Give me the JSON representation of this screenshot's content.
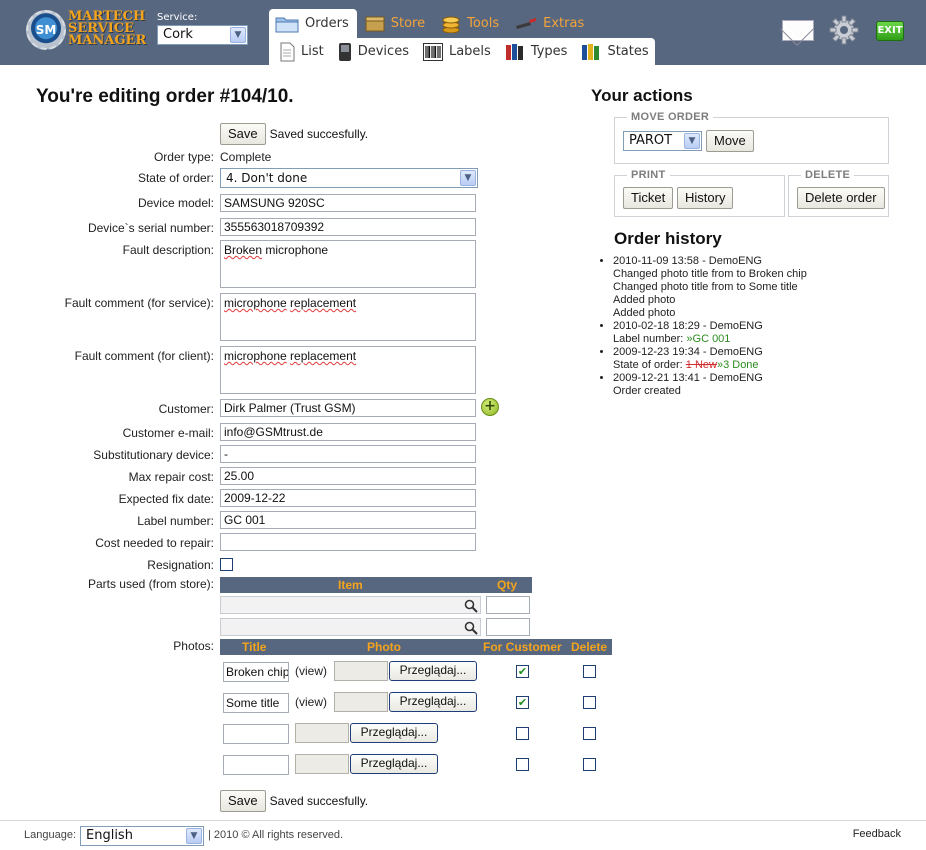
{
  "brand": {
    "logo_badge": "SM",
    "logo_line1": "Martech",
    "logo_line2": "Service",
    "logo_line3": "Manager",
    "accent": "#f4a41c",
    "header_bg": "#57677f"
  },
  "service": {
    "label": "Service:",
    "value": "Cork"
  },
  "nav": {
    "main_tabs": [
      {
        "label": "Orders",
        "icon": "folder-icon"
      },
      {
        "label": "Store",
        "icon": "box-icon"
      },
      {
        "label": "Tools",
        "icon": "coins-icon"
      },
      {
        "label": "Extras",
        "icon": "tools-icon"
      }
    ],
    "sub_tabs": [
      {
        "label": "List",
        "icon": "document-icon"
      },
      {
        "label": "Devices",
        "icon": "phone-icon"
      },
      {
        "label": "Labels",
        "icon": "barcode-icon"
      },
      {
        "label": "Types",
        "icon": "books-icon"
      },
      {
        "label": "States",
        "icon": "books-icon"
      }
    ],
    "exit_label": "EXIT"
  },
  "page_title": "You're editing order #104/10.",
  "save": {
    "button": "Save",
    "message": "Saved succesfully."
  },
  "form": {
    "order_type": {
      "label": "Order type:",
      "value": "Complete"
    },
    "state": {
      "label": "State of order:",
      "value": "4. Don't done"
    },
    "device_model": {
      "label": "Device model:",
      "value": "SAMSUNG 920SC"
    },
    "serial": {
      "label": "Device`s serial number:",
      "value": "355563018709392"
    },
    "fault_description": {
      "label": "Fault description:",
      "value_a": "Broken",
      "value_b": "microphone"
    },
    "fault_comment_service": {
      "label": "Fault comment (for service):",
      "value_a": "microphone",
      "value_b": "replacement"
    },
    "fault_comment_client": {
      "label": "Fault comment (for client):",
      "value_a": "microphone",
      "value_b": "replacement"
    },
    "customer": {
      "label": "Customer:",
      "value": "Dirk Palmer (Trust GSM)"
    },
    "email": {
      "label": "Customer e-mail:",
      "value": "info@GSMtrust.de"
    },
    "substitutionary": {
      "label": "Substitutionary device:",
      "value": "-"
    },
    "max_cost": {
      "label": "Max repair cost:",
      "value": "25.00"
    },
    "fix_date": {
      "label": "Expected fix date:",
      "value": "2009-12-22"
    },
    "label_number": {
      "label": "Label number:",
      "value": "GC 001"
    },
    "cost_needed": {
      "label": "Cost needed to repair:",
      "value": ""
    },
    "resignation": {
      "label": "Resignation:",
      "checked": false
    },
    "parts": {
      "label": "Parts used (from store):",
      "col_item": "Item",
      "col_qty": "Qty"
    },
    "photos": {
      "label": "Photos:",
      "col_title": "Title",
      "col_photo": "Photo",
      "col_for_customer": "For Customer",
      "col_delete": "Delete",
      "view_label": "(view)",
      "browse_label": "Przeglądaj...",
      "rows": [
        {
          "title": "Broken chip",
          "for_customer": true,
          "delete": false
        },
        {
          "title": "Some title",
          "for_customer": true,
          "delete": false
        },
        {
          "title": "",
          "for_customer": false,
          "delete": false
        },
        {
          "title": "",
          "for_customer": false,
          "delete": false
        }
      ]
    }
  },
  "actions": {
    "title": "Your actions",
    "move_legend": "MOVE ORDER",
    "move_target": "PAROT",
    "move_button": "Move",
    "print_legend": "PRINT",
    "ticket_button": "Ticket",
    "history_button": "History",
    "delete_legend": "DELETE",
    "delete_button": "Delete order"
  },
  "history": {
    "title": "Order history",
    "entries": [
      {
        "header": "2010-11-09 13:58 - DemoENG",
        "lines": [
          "Changed photo title from to Broken chip",
          "Changed photo title from to Some title",
          "Added photo",
          "Added photo"
        ]
      },
      {
        "header": "2010-02-18 18:29 - DemoENG",
        "label_prefix": "Label number: ",
        "label_value": "»GC 001"
      },
      {
        "header": "2009-12-23 19:34 - DemoENG",
        "state_prefix": "State of order: ",
        "state_old": "1 New",
        "state_new": "»3 Done"
      },
      {
        "header": "2009-12-21 13:41 - DemoENG",
        "lines": [
          "Order created"
        ]
      }
    ]
  },
  "footer": {
    "language_label": "Language:",
    "language_value": "English",
    "copyright": "| 2010 © All rights reserved.",
    "feedback": "Feedback"
  }
}
